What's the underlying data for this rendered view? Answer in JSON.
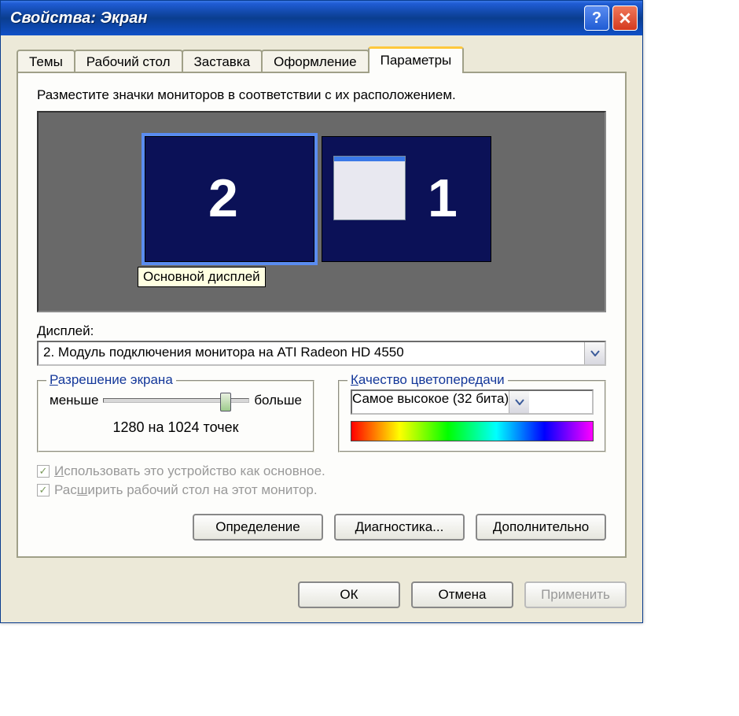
{
  "window": {
    "title": "Свойства: Экран"
  },
  "tabs": {
    "themes": "Темы",
    "desktop": "Рабочий стол",
    "screensaver": "Заставка",
    "appearance": "Оформление",
    "settings": "Параметры"
  },
  "instruction": "Разместите значки мониторов в соответствии с их расположением.",
  "monitors": {
    "mon2": "2",
    "mon1": "1",
    "tooltip": "Основной дисплей"
  },
  "display": {
    "label_pre": "Д",
    "label_rest": "исплей:",
    "value": "2. Модуль подключения монитора на ATI Radeon HD 4550"
  },
  "resolution": {
    "legend_pre": "Р",
    "legend_rest": "азрешение экрана",
    "less": "меньше",
    "more": "больше",
    "value": "1280 на 1024 точек"
  },
  "color": {
    "legend_pre": "К",
    "legend_rest": "ачество цветопередачи",
    "value": "Самое высокое (32 бита)"
  },
  "checkboxes": {
    "primary_pre": "И",
    "primary_rest": "спользовать это устройство как основное.",
    "extend_pre": "Рас",
    "extend_under": "ш",
    "extend_rest": "ирить рабочий стол на этот монитор."
  },
  "buttons": {
    "identify": "Определение",
    "troubleshoot": "Диагностика...",
    "advanced": "Дополнительно",
    "ok": "ОК",
    "cancel": "Отмена",
    "apply": "Применить"
  }
}
